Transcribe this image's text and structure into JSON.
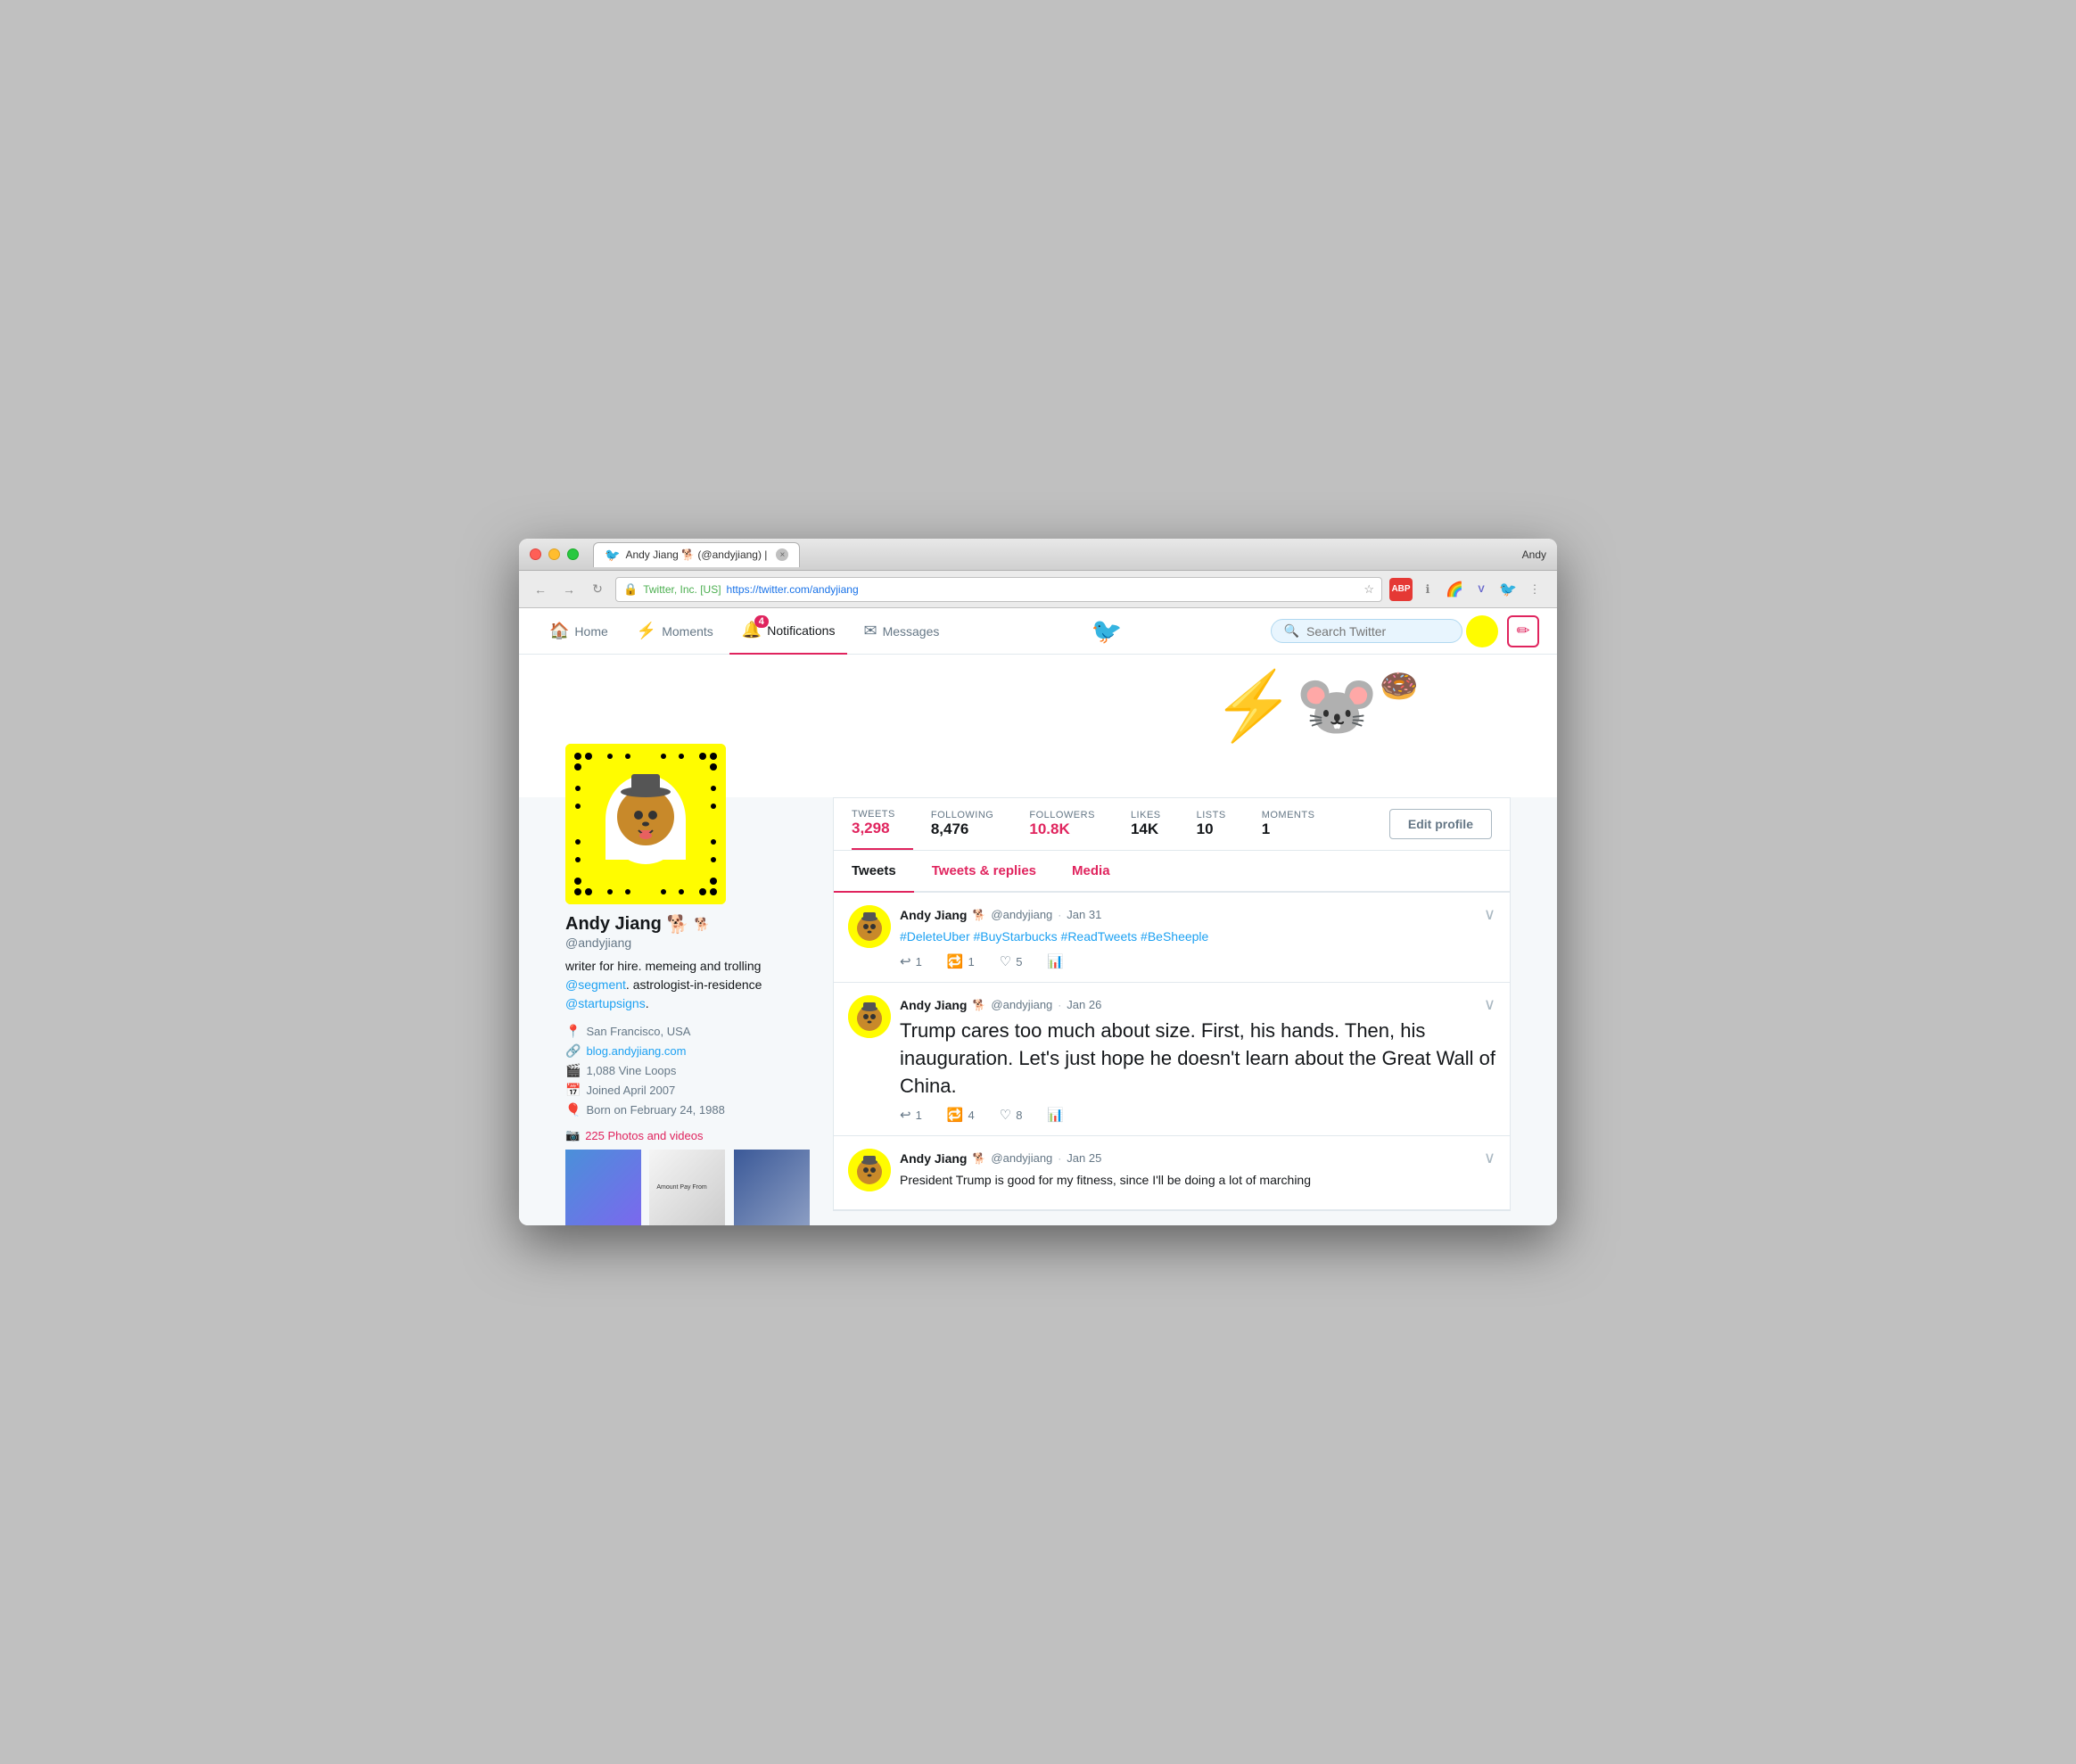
{
  "browser": {
    "tab_title": "Andy Jiang 🐕 (@andyjiang) |",
    "tab_close": "×",
    "url_company": "Twitter, Inc. [US]",
    "url_full": "https://twitter.com/andyjiang",
    "user_label": "Andy"
  },
  "nav": {
    "home_label": "Home",
    "moments_label": "Moments",
    "notifications_label": "Notifications",
    "notifications_badge": "4",
    "messages_label": "Messages",
    "search_placeholder": "Search Twitter"
  },
  "profile": {
    "name": "Andy Jiang",
    "emoji": "🐕",
    "handle": "@andyjiang",
    "bio": "writer for hire. memeing and trolling",
    "bio_link1": "@segment",
    "bio_text2": ". astrologist-in-residence",
    "bio_link2": "@startupsigns",
    "bio_end": ".",
    "location": "San Francisco, USA",
    "website": "blog.andyjiang.com",
    "vine": "1,088 Vine Loops",
    "joined": "Joined April 2007",
    "born": "Born on February 24, 1988",
    "photos_label": "225 Photos and videos"
  },
  "stats": {
    "tweets_label": "TWEETS",
    "tweets_value": "3,298",
    "following_label": "FOLLOWING",
    "following_value": "8,476",
    "followers_label": "FOLLOWERS",
    "followers_value": "10.8K",
    "likes_label": "LIKES",
    "likes_value": "14K",
    "lists_label": "LISTS",
    "lists_value": "10",
    "moments_label": "MOMENTS",
    "moments_value": "1",
    "edit_profile": "Edit profile"
  },
  "tabs": {
    "tweets": "Tweets",
    "replies": "Tweets & replies",
    "media": "Media"
  },
  "tweets": [
    {
      "name": "Andy Jiang",
      "emoji": "🐕",
      "handle": "@andyjiang",
      "date": "Jan 31",
      "text": "#DeleteUber #BuyStarbucks #ReadTweets #BeSheeple",
      "is_large": false,
      "reply_count": "1",
      "retweet_count": "1",
      "like_count": "5"
    },
    {
      "name": "Andy Jiang",
      "emoji": "🐕",
      "handle": "@andyjiang",
      "date": "Jan 26",
      "text": "Trump cares too much about size. First, his hands. Then, his inauguration. Let's just hope he doesn't learn about the Great Wall of China.",
      "is_large": true,
      "reply_count": "1",
      "retweet_count": "4",
      "like_count": "8"
    },
    {
      "name": "Andy Jiang",
      "emoji": "🐕",
      "handle": "@andyjiang",
      "date": "Jan 25",
      "text": "President Trump is good for my fitness, since I'll be doing a lot of marching",
      "is_large": false,
      "reply_count": "",
      "retweet_count": "",
      "like_count": ""
    }
  ],
  "colors": {
    "twitter_blue": "#1da1f2",
    "red_pink": "#e0245e",
    "dark_text": "#14171a",
    "light_text": "#657786"
  }
}
